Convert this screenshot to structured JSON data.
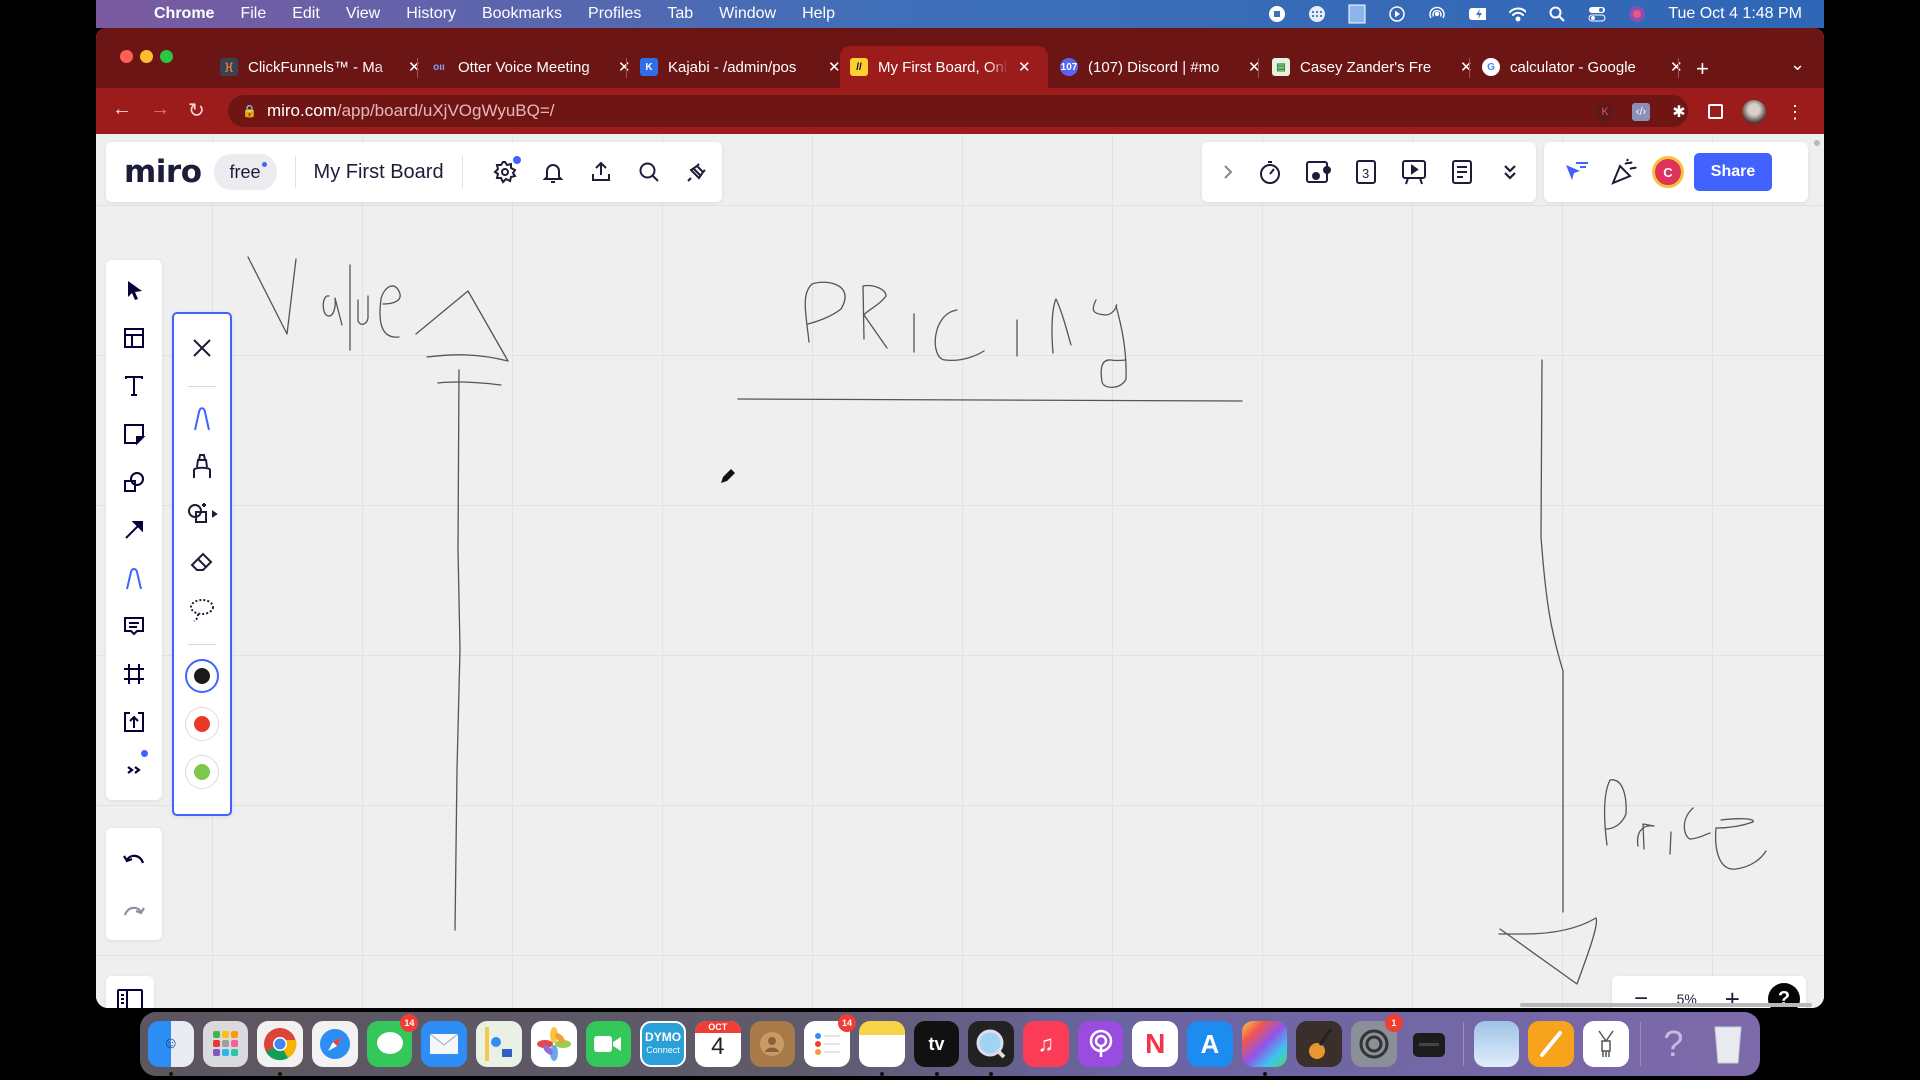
{
  "menubar": {
    "apple_icon": "apple-logo",
    "items": [
      "Chrome",
      "File",
      "Edit",
      "View",
      "History",
      "Bookmarks",
      "Profiles",
      "Tab",
      "Window",
      "Help"
    ],
    "status_icons": [
      "screen-record-icon",
      "keyboard-icon",
      "dymo-icon",
      "play-icon",
      "airdrop-icon",
      "battery-charging-icon",
      "wifi-icon",
      "search-icon",
      "control-center-icon",
      "siri-icon"
    ],
    "clock": "Tue Oct 4  1:48 PM"
  },
  "browser": {
    "tabs": [
      {
        "title": "ClickFunnels™ - Ma",
        "icon": "clickfunnels-icon",
        "active": false
      },
      {
        "title": "Otter Voice Meeting",
        "icon": "otter-icon",
        "active": false
      },
      {
        "title": "Kajabi - /admin/pos",
        "icon": "kajabi-icon",
        "active": false
      },
      {
        "title": "My First Board, Onl",
        "icon": "miro-icon",
        "active": true
      },
      {
        "title": "(107) Discord | #mo",
        "icon": "discord-icon",
        "badge": "107",
        "active": false
      },
      {
        "title": "Casey Zander's Fre",
        "icon": "page-icon",
        "active": false
      },
      {
        "title": "calculator - Google",
        "icon": "google-icon",
        "active": false
      }
    ],
    "new_tab_label": "+",
    "tab_search_label": "⌄",
    "url_host": "miro.com",
    "url_path": "/app/board/uXjVOgWyuBQ=/",
    "profile_letter": "K"
  },
  "miro": {
    "logo": "miro",
    "plan": "free",
    "board_name": "My First Board",
    "top_icons": [
      "settings-icon",
      "notifications-icon",
      "export-icon",
      "search-icon",
      "integrations-icon"
    ],
    "collab_icons": [
      "expand-icon",
      "timer-icon",
      "video-chat-icon",
      "voting-icon",
      "presentation-icon",
      "notes-icon",
      "more-icon"
    ],
    "share_label": "Share",
    "avatar_letter": "C",
    "zoom_level": "5%",
    "zoom_out_label": "−",
    "zoom_in_label": "+",
    "help_label": "?",
    "left_tools": [
      "select",
      "templates",
      "text",
      "sticky-note",
      "shapes",
      "connection-line",
      "pen",
      "comment",
      "frame",
      "upload",
      "more-tools"
    ],
    "pen_tools": [
      "close",
      "pen",
      "highlighter",
      "smart-drawing",
      "eraser",
      "lasso"
    ],
    "pen_colors": [
      {
        "name": "black",
        "hex": "#1a1a1a",
        "selected": true
      },
      {
        "name": "red",
        "hex": "#e83a26",
        "selected": false
      },
      {
        "name": "green",
        "hex": "#7dc74a",
        "selected": false
      }
    ]
  },
  "canvas": {
    "handwriting": [
      {
        "text": "Value",
        "note": "with upward arrow"
      },
      {
        "text": "PRICING",
        "note": "underlined title"
      },
      {
        "text": "Price",
        "note": "with downward arrow"
      }
    ]
  },
  "dock": {
    "apps": [
      {
        "name": "finder",
        "running": true
      },
      {
        "name": "launchpad"
      },
      {
        "name": "chrome",
        "running": true
      },
      {
        "name": "safari"
      },
      {
        "name": "messages",
        "badge": "14"
      },
      {
        "name": "mail"
      },
      {
        "name": "maps"
      },
      {
        "name": "photos"
      },
      {
        "name": "facetime"
      },
      {
        "name": "dymo-connect",
        "label_top": "DYMO",
        "label_bottom": "Connect"
      },
      {
        "name": "calendar",
        "month": "OCT",
        "day": "4"
      },
      {
        "name": "contacts"
      },
      {
        "name": "reminders",
        "badge": "14"
      },
      {
        "name": "notes",
        "running": true
      },
      {
        "name": "apple-tv",
        "label": "tv",
        "running": true
      },
      {
        "name": "quicktime",
        "running": true
      },
      {
        "name": "music"
      },
      {
        "name": "podcasts"
      },
      {
        "name": "news"
      },
      {
        "name": "app-store"
      },
      {
        "name": "final-cut-pro",
        "running": true
      },
      {
        "name": "garageband"
      },
      {
        "name": "system-preferences",
        "badge": "1"
      },
      {
        "name": "label-printer"
      },
      {
        "name": "preview-stack"
      },
      {
        "name": "pages-stack"
      },
      {
        "name": "utility-stack"
      },
      {
        "name": "help"
      },
      {
        "name": "trash"
      }
    ]
  }
}
